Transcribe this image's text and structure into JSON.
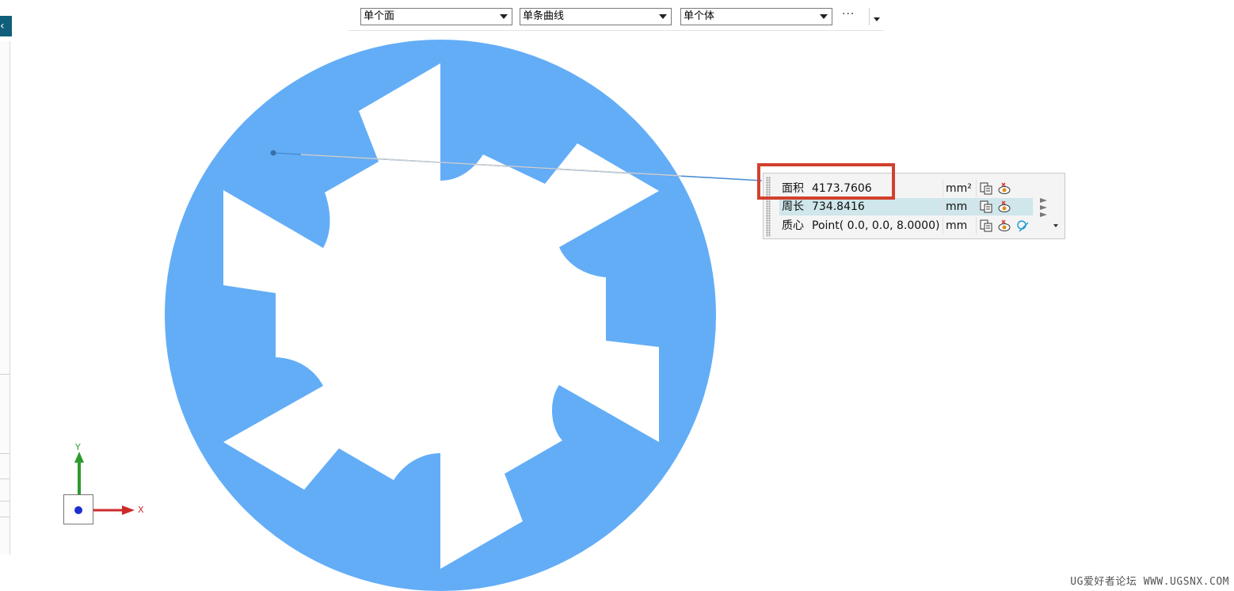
{
  "selection_toolbar": {
    "face_filter": "单个面",
    "curve_filter": "单条曲线",
    "body_filter": "单个体",
    "more_label": "···"
  },
  "measurement": {
    "rows": [
      {
        "name": "面积",
        "value": "4173.7606",
        "unit": "mm²",
        "icons": [
          "copy-icon",
          "show-icon"
        ]
      },
      {
        "name": "周长",
        "value": "734.8416",
        "unit": "mm",
        "icons": [
          "copy-icon",
          "show-icon"
        ]
      },
      {
        "name": "质心",
        "value": "Point( 0.0, 0.0, 8.0000)",
        "unit": "mm",
        "icons": [
          "copy-icon",
          "show-icon",
          "point-icon"
        ]
      }
    ]
  },
  "triad": {
    "x_label": "X",
    "y_label": "Y"
  },
  "watermark": "UG爱好者论坛 WWW.UGSNX.COM",
  "colors": {
    "face": "#63adf7",
    "highlight": "#d2412e",
    "selected_row": "#cfe6ea",
    "left_tab": "#0f5f7a"
  }
}
